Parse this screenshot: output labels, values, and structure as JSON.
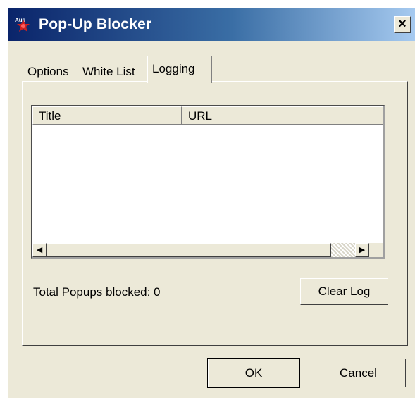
{
  "window": {
    "title": "Pop-Up Blocker",
    "close_label": "×"
  },
  "tabs": [
    {
      "label": "Options",
      "active": false
    },
    {
      "label": "White List",
      "active": false
    },
    {
      "label": "Logging",
      "active": true
    }
  ],
  "log": {
    "columns": [
      "Title",
      "URL"
    ],
    "rows": [],
    "scroll_left_icon": "arrow-left-icon",
    "scroll_right_icon": "arrow-right-icon"
  },
  "status": {
    "total_blocked_text": "Total Popups blocked: 0"
  },
  "buttons": {
    "clear_log": "Clear Log",
    "ok": "OK",
    "cancel": "Cancel"
  },
  "colors": {
    "titlebar_start": "#0a246a",
    "titlebar_end": "#a6caf0",
    "face": "#ece9d8"
  }
}
